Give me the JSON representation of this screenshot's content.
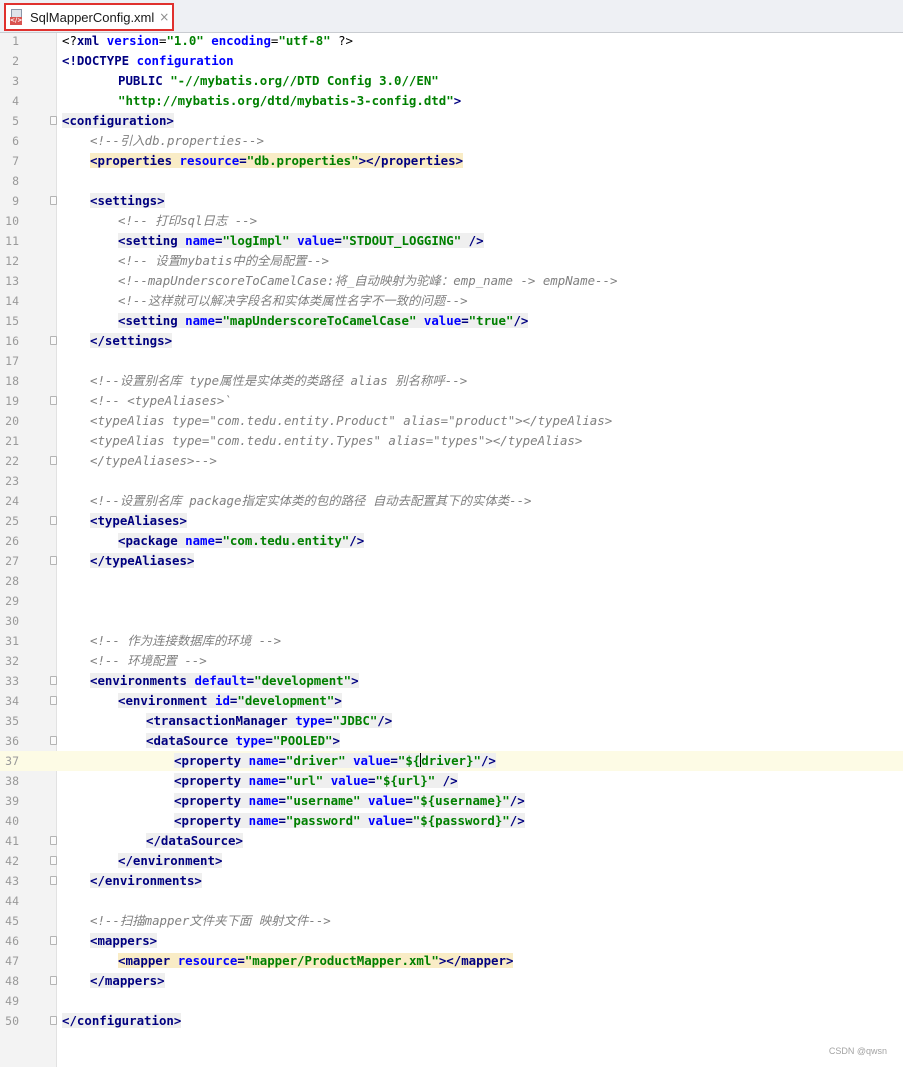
{
  "editor": {
    "tab": {
      "filename": "SqlMapperConfig.xml",
      "icon": "xml-file-icon",
      "close": "×"
    },
    "active_line": 37,
    "watermark": "CSDN @qwsn"
  },
  "lines": [
    {
      "n": "1",
      "fold": false,
      "i": 0,
      "s": [
        [
          "p",
          "<?"
        ],
        [
          "t",
          "xml "
        ],
        [
          "a",
          "version"
        ],
        [
          "p",
          "="
        ],
        [
          "v",
          "\"1.0\""
        ],
        [
          "p",
          " "
        ],
        [
          "a",
          "encoding"
        ],
        [
          "p",
          "="
        ],
        [
          "v",
          "\"utf-8\""
        ],
        [
          "p",
          " ?>"
        ]
      ]
    },
    {
      "n": "2",
      "fold": false,
      "i": 0,
      "s": [
        [
          "t",
          "<!DOCTYPE "
        ],
        [
          "a",
          "configuration"
        ]
      ]
    },
    {
      "n": "3",
      "fold": false,
      "i": 8,
      "s": [
        [
          "t",
          "PUBLIC "
        ],
        [
          "v",
          "\"-//mybatis.org//DTD Config 3.0//EN\""
        ]
      ]
    },
    {
      "n": "4",
      "fold": false,
      "i": 8,
      "s": [
        [
          "v",
          "\"http://mybatis.org/dtd/mybatis-3-config.dtd\""
        ],
        [
          "t",
          ">"
        ]
      ]
    },
    {
      "n": "5",
      "fold": true,
      "i": 0,
      "bg": "hl",
      "s": [
        [
          "t",
          "<configuration>"
        ]
      ]
    },
    {
      "n": "6",
      "fold": false,
      "i": 4,
      "s": [
        [
          "c",
          "<!--引入db.properties-->"
        ]
      ]
    },
    {
      "n": "7",
      "fold": false,
      "i": 4,
      "bg": "yl",
      "s": [
        [
          "t",
          "<properties "
        ],
        [
          "a",
          "resource"
        ],
        [
          "t",
          "="
        ],
        [
          "v",
          "\"db.properties\""
        ],
        [
          "t",
          "></properties>"
        ]
      ]
    },
    {
      "n": "8",
      "fold": false,
      "i": 0,
      "s": []
    },
    {
      "n": "9",
      "fold": true,
      "i": 4,
      "bg": "hl",
      "s": [
        [
          "t",
          "<settings>"
        ]
      ]
    },
    {
      "n": "10",
      "fold": false,
      "i": 8,
      "s": [
        [
          "c",
          "<!-- 打印sql日志 -->"
        ]
      ]
    },
    {
      "n": "11",
      "fold": false,
      "i": 8,
      "bg": "hl",
      "s": [
        [
          "t",
          "<setting "
        ],
        [
          "a",
          "name"
        ],
        [
          "t",
          "="
        ],
        [
          "v",
          "\"logImpl\""
        ],
        [
          "t",
          " "
        ],
        [
          "a",
          "value"
        ],
        [
          "t",
          "="
        ],
        [
          "v",
          "\"STDOUT_LOGGING\""
        ],
        [
          "t",
          " />"
        ]
      ]
    },
    {
      "n": "12",
      "fold": false,
      "i": 8,
      "s": [
        [
          "c",
          "<!-- 设置mybatis中的全局配置-->"
        ]
      ]
    },
    {
      "n": "13",
      "fold": false,
      "i": 8,
      "s": [
        [
          "c",
          "<!--mapUnderscoreToCamelCase:将_自动映射为驼峰：emp_name -> empName-->"
        ]
      ]
    },
    {
      "n": "14",
      "fold": false,
      "i": 8,
      "s": [
        [
          "c",
          "<!--这样就可以解决字段名和实体类属性名字不一致的问题-->"
        ]
      ]
    },
    {
      "n": "15",
      "fold": false,
      "i": 8,
      "bg": "hl",
      "s": [
        [
          "t",
          "<setting "
        ],
        [
          "a",
          "name"
        ],
        [
          "t",
          "="
        ],
        [
          "v",
          "\"mapUnderscoreToCamelCase\""
        ],
        [
          "t",
          " "
        ],
        [
          "a",
          "value"
        ],
        [
          "t",
          "="
        ],
        [
          "v",
          "\"true\""
        ],
        [
          "t",
          "/>"
        ]
      ]
    },
    {
      "n": "16",
      "fold": true,
      "i": 4,
      "bg": "hl",
      "s": [
        [
          "t",
          "</settings>"
        ]
      ]
    },
    {
      "n": "17",
      "fold": false,
      "i": 0,
      "s": []
    },
    {
      "n": "18",
      "fold": false,
      "i": 4,
      "s": [
        [
          "c",
          "<!--设置别名库 type属性是实体类的类路径 alias 别名称呼-->"
        ]
      ]
    },
    {
      "n": "19",
      "fold": true,
      "i": 4,
      "s": [
        [
          "c",
          "<!-- <typeAliases>`"
        ]
      ]
    },
    {
      "n": "20",
      "fold": false,
      "i": 4,
      "s": [
        [
          "c",
          "<typeAlias type=\"com.tedu.entity.Product\" alias=\"product\"></typeAlias>"
        ]
      ]
    },
    {
      "n": "21",
      "fold": false,
      "i": 4,
      "s": [
        [
          "c",
          "<typeAlias type=\"com.tedu.entity.Types\" alias=\"types\"></typeAlias>"
        ]
      ]
    },
    {
      "n": "22",
      "fold": true,
      "i": 4,
      "s": [
        [
          "c",
          "</typeAliases>-->"
        ]
      ]
    },
    {
      "n": "23",
      "fold": false,
      "i": 0,
      "s": []
    },
    {
      "n": "24",
      "fold": false,
      "i": 4,
      "s": [
        [
          "c",
          "<!--设置别名库 package指定实体类的包的路径 自动去配置其下的实体类-->"
        ]
      ]
    },
    {
      "n": "25",
      "fold": true,
      "i": 4,
      "bg": "hl",
      "s": [
        [
          "t",
          "<typeAliases>"
        ]
      ]
    },
    {
      "n": "26",
      "fold": false,
      "i": 8,
      "bg": "hl",
      "s": [
        [
          "t",
          "<package "
        ],
        [
          "a",
          "name"
        ],
        [
          "t",
          "="
        ],
        [
          "v",
          "\"com.tedu.entity\""
        ],
        [
          "t",
          "/>"
        ]
      ]
    },
    {
      "n": "27",
      "fold": true,
      "i": 4,
      "bg": "hl",
      "s": [
        [
          "t",
          "</typeAliases>"
        ]
      ]
    },
    {
      "n": "28",
      "fold": false,
      "i": 0,
      "s": []
    },
    {
      "n": "29",
      "fold": false,
      "i": 0,
      "s": []
    },
    {
      "n": "30",
      "fold": false,
      "i": 0,
      "s": []
    },
    {
      "n": "31",
      "fold": false,
      "i": 4,
      "s": [
        [
          "c",
          "<!-- 作为连接数据库的环境 -->"
        ]
      ]
    },
    {
      "n": "32",
      "fold": false,
      "i": 4,
      "s": [
        [
          "c",
          "<!-- 环境配置 -->"
        ]
      ]
    },
    {
      "n": "33",
      "fold": true,
      "i": 4,
      "bg": "hl",
      "s": [
        [
          "t",
          "<environments "
        ],
        [
          "a",
          "default"
        ],
        [
          "t",
          "="
        ],
        [
          "v",
          "\"development\""
        ],
        [
          "t",
          ">"
        ]
      ]
    },
    {
      "n": "34",
      "fold": true,
      "i": 8,
      "bg": "hl",
      "s": [
        [
          "t",
          "<environment "
        ],
        [
          "a",
          "id"
        ],
        [
          "t",
          "="
        ],
        [
          "v",
          "\"development\""
        ],
        [
          "t",
          ">"
        ]
      ]
    },
    {
      "n": "35",
      "fold": false,
      "i": 12,
      "bg": "hl",
      "s": [
        [
          "t",
          "<transactionManager "
        ],
        [
          "a",
          "type"
        ],
        [
          "t",
          "="
        ],
        [
          "v",
          "\"JDBC\""
        ],
        [
          "t",
          "/>"
        ]
      ]
    },
    {
      "n": "36",
      "fold": true,
      "i": 12,
      "bg": "hl",
      "s": [
        [
          "t",
          "<dataSource "
        ],
        [
          "a",
          "type"
        ],
        [
          "t",
          "="
        ],
        [
          "v",
          "\"POOLED\""
        ],
        [
          "t",
          ">"
        ]
      ]
    },
    {
      "n": "37",
      "fold": false,
      "i": 16,
      "bg": "hl",
      "s": [
        [
          "t",
          "<property "
        ],
        [
          "a",
          "name"
        ],
        [
          "t",
          "="
        ],
        [
          "v",
          "\"driver\""
        ],
        [
          "t",
          " "
        ],
        [
          "a",
          "value"
        ],
        [
          "t",
          "="
        ],
        [
          "v",
          "\"${"
        ],
        [
          "cur",
          ""
        ],
        [
          "v",
          "driver}\""
        ],
        [
          "t",
          "/>"
        ]
      ]
    },
    {
      "n": "38",
      "fold": false,
      "i": 16,
      "bg": "hl",
      "s": [
        [
          "t",
          "<property "
        ],
        [
          "a",
          "name"
        ],
        [
          "t",
          "="
        ],
        [
          "v",
          "\"url\""
        ],
        [
          "t",
          " "
        ],
        [
          "a",
          "value"
        ],
        [
          "t",
          "="
        ],
        [
          "v",
          "\"${url}\""
        ],
        [
          "t",
          " />"
        ]
      ]
    },
    {
      "n": "39",
      "fold": false,
      "i": 16,
      "bg": "hl",
      "s": [
        [
          "t",
          "<property "
        ],
        [
          "a",
          "name"
        ],
        [
          "t",
          "="
        ],
        [
          "v",
          "\"username\""
        ],
        [
          "t",
          " "
        ],
        [
          "a",
          "value"
        ],
        [
          "t",
          "="
        ],
        [
          "v",
          "\"${username}\""
        ],
        [
          "t",
          "/>"
        ]
      ]
    },
    {
      "n": "40",
      "fold": false,
      "i": 16,
      "bg": "hl",
      "s": [
        [
          "t",
          "<property "
        ],
        [
          "a",
          "name"
        ],
        [
          "t",
          "="
        ],
        [
          "v",
          "\"password\""
        ],
        [
          "t",
          " "
        ],
        [
          "a",
          "value"
        ],
        [
          "t",
          "="
        ],
        [
          "v",
          "\"${password}\""
        ],
        [
          "t",
          "/>"
        ]
      ]
    },
    {
      "n": "41",
      "fold": true,
      "i": 12,
      "bg": "hl",
      "s": [
        [
          "t",
          "</dataSource>"
        ]
      ]
    },
    {
      "n": "42",
      "fold": true,
      "i": 8,
      "bg": "hl",
      "s": [
        [
          "t",
          "</environment>"
        ]
      ]
    },
    {
      "n": "43",
      "fold": true,
      "i": 4,
      "bg": "hl",
      "s": [
        [
          "t",
          "</environments>"
        ]
      ]
    },
    {
      "n": "44",
      "fold": false,
      "i": 0,
      "s": []
    },
    {
      "n": "45",
      "fold": false,
      "i": 4,
      "s": [
        [
          "c",
          "<!--扫描mapper文件夹下面 映射文件-->"
        ]
      ]
    },
    {
      "n": "46",
      "fold": true,
      "i": 4,
      "bg": "hl",
      "s": [
        [
          "t",
          "<mappers>"
        ]
      ]
    },
    {
      "n": "47",
      "fold": false,
      "i": 8,
      "bg": "yl",
      "s": [
        [
          "t",
          "<mapper "
        ],
        [
          "a",
          "resource"
        ],
        [
          "t",
          "="
        ],
        [
          "v",
          "\"mapper/ProductMapper.xml\""
        ],
        [
          "t",
          "></mapper>"
        ]
      ]
    },
    {
      "n": "48",
      "fold": true,
      "i": 4,
      "bg": "hl",
      "s": [
        [
          "t",
          "</mappers>"
        ]
      ]
    },
    {
      "n": "49",
      "fold": false,
      "i": 0,
      "s": []
    },
    {
      "n": "50",
      "fold": true,
      "i": 0,
      "bg": "hl",
      "s": [
        [
          "t",
          "</configuration>"
        ]
      ]
    }
  ]
}
